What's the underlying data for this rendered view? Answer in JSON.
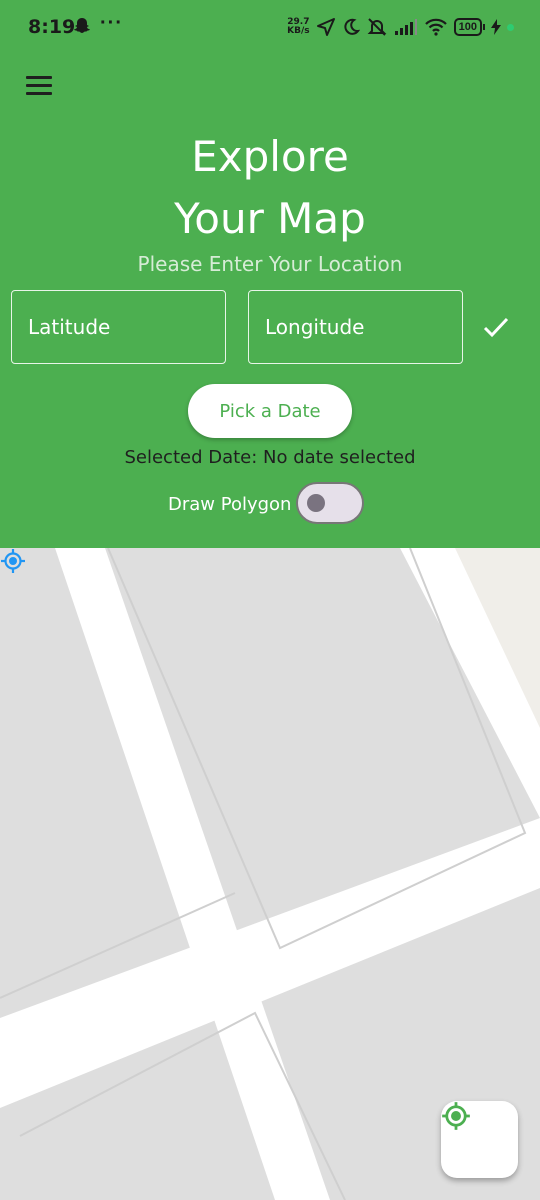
{
  "status_bar": {
    "time": "8:19",
    "snapchat_icon": "ghost-icon",
    "more_icon": "dots",
    "net_speed_value": "29.7",
    "net_speed_unit": "KB/s",
    "battery_level": "100",
    "icons": [
      "location-arrow-icon",
      "moon-icon",
      "bell-off-icon",
      "signal-icon",
      "wifi-icon",
      "battery-icon",
      "charging-icon"
    ]
  },
  "header": {
    "menu_icon": "hamburger-menu-icon",
    "title_line1": "Explore",
    "title_line2": "Your Map",
    "subtitle": "Please Enter Your Location"
  },
  "form": {
    "latitude_placeholder": "Latitude",
    "longitude_placeholder": "Longitude",
    "confirm_icon": "check-icon",
    "date_button_label": "Pick a Date",
    "selected_date_text": "Selected Date: No date selected",
    "draw_polygon_label": "Draw Polygon",
    "draw_polygon_on": false
  },
  "map": {
    "user_location_icon": "my-location-icon",
    "fab_icon": "gps-fixed-icon"
  },
  "colors": {
    "primary": "#4caf50",
    "map_background": "#dedede",
    "road": "#ffffff",
    "location_blue": "#2196f3"
  }
}
